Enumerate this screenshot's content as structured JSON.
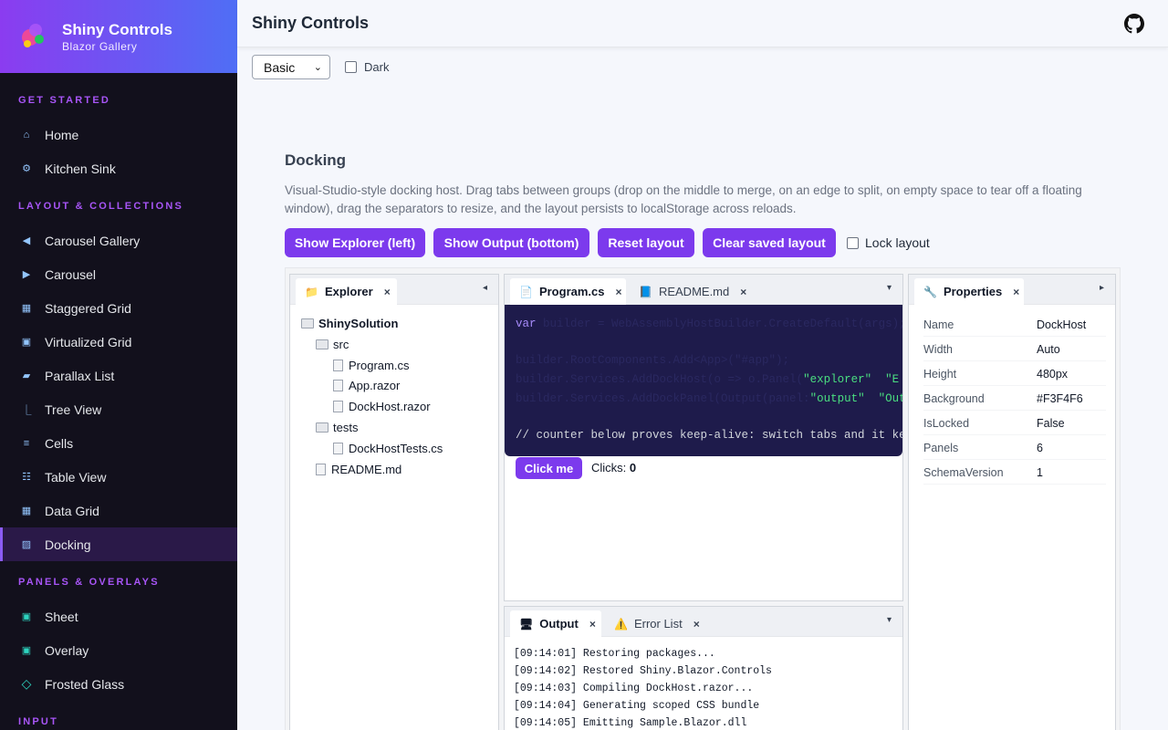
{
  "brand": {
    "title": "Shiny Controls",
    "subtitle": "Blazor Gallery"
  },
  "sidebar": {
    "sections": [
      {
        "label": "GET STARTED",
        "items": [
          {
            "label": "Home",
            "icon": "home-icon",
            "glyph": "⌂"
          },
          {
            "label": "Kitchen Sink",
            "icon": "gear-icon",
            "glyph": "⚙"
          }
        ]
      },
      {
        "label": "LAYOUT & COLLECTIONS",
        "items": [
          {
            "label": "Carousel Gallery",
            "icon": "triangle-left-icon",
            "glyph": "◀"
          },
          {
            "label": "Carousel",
            "icon": "triangle-right-icon",
            "glyph": "▶"
          },
          {
            "label": "Staggered Grid",
            "icon": "grid-icon",
            "glyph": "▦"
          },
          {
            "label": "Virtualized Grid",
            "icon": "square-icon",
            "glyph": "▣"
          },
          {
            "label": "Parallax List",
            "icon": "parallelogram-icon",
            "glyph": "▰"
          },
          {
            "label": "Tree View",
            "icon": "tree-icon",
            "glyph": "⎿"
          },
          {
            "label": "Cells",
            "icon": "lines-icon",
            "glyph": "≡"
          },
          {
            "label": "Table View",
            "icon": "table-icon",
            "glyph": "☷"
          },
          {
            "label": "Data Grid",
            "icon": "datagrid-icon",
            "glyph": "▦"
          },
          {
            "label": "Docking",
            "icon": "docking-icon",
            "glyph": "▨",
            "active": true
          }
        ]
      },
      {
        "label": "PANELS & OVERLAYS",
        "items": [
          {
            "label": "Sheet",
            "icon": "sheet-icon",
            "glyph": "▣"
          },
          {
            "label": "Overlay",
            "icon": "overlay-icon",
            "glyph": "▣"
          },
          {
            "label": "Frosted Glass",
            "icon": "diamond-icon",
            "glyph": "◇"
          }
        ]
      },
      {
        "label": "INPUT",
        "items": []
      }
    ]
  },
  "topbar": {
    "title": "Shiny Controls"
  },
  "theme": {
    "selected": "Basic",
    "dark_label": "Dark"
  },
  "page": {
    "title": "Docking",
    "description": "Visual-Studio-style docking host. Drag tabs between groups (drop on the middle to merge, on an edge to split, on empty space to tear off a floating window), drag the separators to resize, and the layout persists to localStorage across reloads."
  },
  "toolbar": {
    "show_explorer": "Show Explorer (left)",
    "show_output": "Show Output (bottom)",
    "reset": "Reset layout",
    "clear": "Clear saved layout",
    "lock": "Lock layout"
  },
  "explorer": {
    "tab": "Explorer",
    "tree": [
      {
        "label": "ShinySolution",
        "type": "folder",
        "level": 0,
        "bold": true
      },
      {
        "label": "src",
        "type": "folder",
        "level": 1
      },
      {
        "label": "Program.cs",
        "type": "file",
        "level": 2
      },
      {
        "label": "App.razor",
        "type": "file",
        "level": 2
      },
      {
        "label": "DockHost.razor",
        "type": "file",
        "level": 2
      },
      {
        "label": "tests",
        "type": "folder",
        "level": 1
      },
      {
        "label": "DockHostTests.cs",
        "type": "file",
        "level": 2
      },
      {
        "label": "README.md",
        "type": "file",
        "level": 1
      }
    ]
  },
  "editor": {
    "tabs": [
      "Program.cs",
      "README.md"
    ],
    "code": {
      "line1_kw": "var",
      "line1_rest": " builder = WebAssemblyHostBuilder.CreateDefault(args);",
      "line3": "builder.RootComponents.Add<App>(\"#app\");",
      "line4_pre": "builder.Services.AddDockHost(o => o.Panel(",
      "line4_s1": "\"explorer\"",
      "line4_s2": "\"E",
      "line5_pre": "builder.Services.AddDockPanel(Output(panel:",
      "line5_s1": "\"output\"",
      "line5_s2": "\"Outpu",
      "comment": "// counter below proves keep-alive: switch tabs and it keep"
    },
    "click_label": "Click me",
    "clicks_label": "Clicks:",
    "clicks_value": "0"
  },
  "output": {
    "tabs": [
      "Output",
      "Error List"
    ],
    "lines": [
      "[09:14:01] Restoring packages...",
      "[09:14:02] Restored Shiny.Blazor.Controls",
      "[09:14:03] Compiling DockHost.razor...",
      "[09:14:04] Generating scoped CSS bundle",
      "[09:14:05] Emitting Sample.Blazor.dll"
    ]
  },
  "properties": {
    "tab": "Properties",
    "rows": [
      {
        "key": "Name",
        "value": "DockHost"
      },
      {
        "key": "Width",
        "value": "Auto"
      },
      {
        "key": "Height",
        "value": "480px"
      },
      {
        "key": "Background",
        "value": "#F3F4F6"
      },
      {
        "key": "IsLocked",
        "value": "False"
      },
      {
        "key": "Panels",
        "value": "6"
      },
      {
        "key": "SchemaVersion",
        "value": "1"
      }
    ]
  },
  "colors": {
    "accent": "#7c3aed",
    "sidebar_bg": "#12101c",
    "code_bg": "#1e1b4b"
  }
}
